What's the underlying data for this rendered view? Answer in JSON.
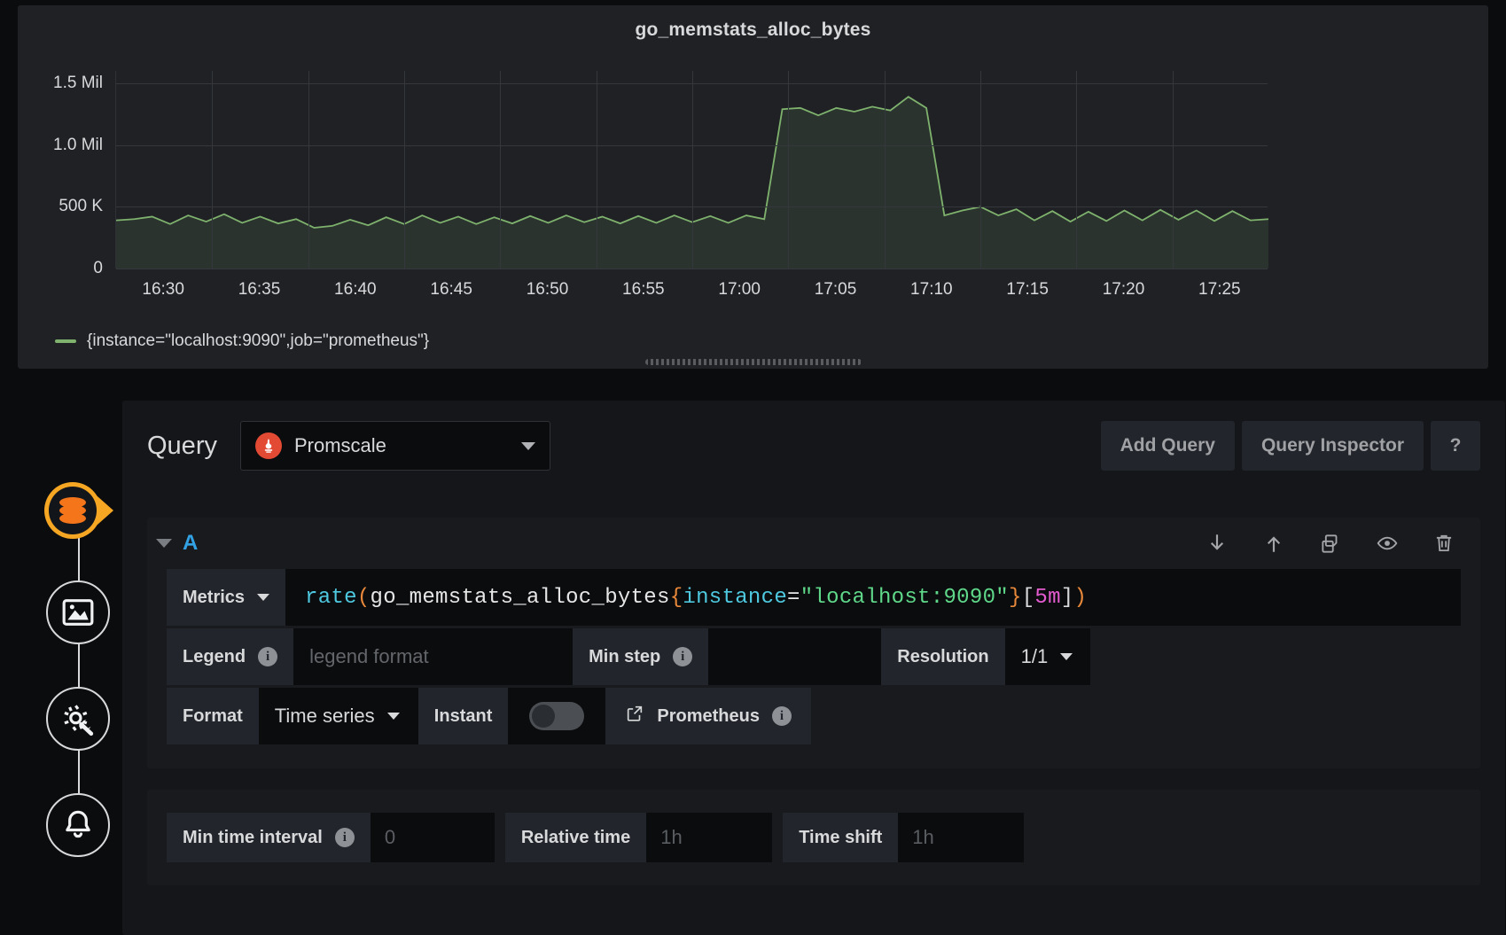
{
  "panel": {
    "title": "go_memstats_alloc_bytes",
    "legend_series": "{instance=\"localhost:9090\",job=\"prometheus\"}",
    "series_color": "#7eb26d"
  },
  "chart_data": {
    "type": "area",
    "title": "go_memstats_alloc_bytes",
    "xlabel": "",
    "ylabel": "",
    "grid": true,
    "legend_position": "bottom-left",
    "ytick_labels": [
      "1.5 Mil",
      "1.0 Mil",
      "500 K",
      "0"
    ],
    "ytick_values": [
      1500000,
      1000000,
      500000,
      0
    ],
    "ylim": [
      0,
      1600000
    ],
    "xtick_labels": [
      "16:30",
      "16:35",
      "16:40",
      "16:45",
      "16:50",
      "16:55",
      "17:00",
      "17:05",
      "17:10",
      "17:15",
      "17:20",
      "17:25"
    ],
    "series": [
      {
        "name": "{instance=\"localhost:9090\",job=\"prometheus\"}",
        "color": "#7eb26d",
        "x": [
          "16:28",
          "16:29",
          "16:30",
          "16:31",
          "16:32",
          "16:33",
          "16:34",
          "16:35",
          "16:36",
          "16:37",
          "16:38",
          "16:39",
          "16:40",
          "16:41",
          "16:42",
          "16:43",
          "16:44",
          "16:45",
          "16:46",
          "16:47",
          "16:48",
          "16:49",
          "16:50",
          "16:51",
          "16:52",
          "16:53",
          "16:54",
          "16:55",
          "16:56",
          "16:57",
          "16:58",
          "16:59",
          "17:00",
          "17:01",
          "17:02",
          "17:03",
          "17:04",
          "17:05",
          "17:06",
          "17:07",
          "17:08",
          "17:09",
          "17:10",
          "17:11",
          "17:12",
          "17:13",
          "17:14",
          "17:15",
          "17:16",
          "17:17",
          "17:18",
          "17:19",
          "17:20",
          "17:21",
          "17:22",
          "17:23",
          "17:24",
          "17:25",
          "17:26"
        ],
        "values": [
          390000,
          400000,
          420000,
          360000,
          430000,
          380000,
          440000,
          370000,
          420000,
          365000,
          400000,
          330000,
          345000,
          395000,
          350000,
          415000,
          360000,
          430000,
          370000,
          420000,
          360000,
          415000,
          365000,
          425000,
          370000,
          430000,
          375000,
          420000,
          365000,
          425000,
          370000,
          430000,
          375000,
          425000,
          370000,
          430000,
          400000,
          1290000,
          1300000,
          1240000,
          1300000,
          1270000,
          1310000,
          1280000,
          1390000,
          1300000,
          430000,
          470000,
          500000,
          430000,
          480000,
          390000,
          465000,
          380000,
          460000,
          385000,
          470000,
          390000,
          475000,
          395000,
          470000,
          385000,
          465000,
          390000,
          400000
        ]
      }
    ]
  },
  "query": {
    "section_label": "Query",
    "datasource_name": "Promscale",
    "datasource_icon": "prometheus-flame-icon",
    "add_query_label": "Add Query",
    "query_inspector_label": "Query Inspector",
    "help_label": "?",
    "ref_id": "A",
    "row_icons": [
      {
        "name": "move-query-down-icon",
        "glyph": "arrow-down"
      },
      {
        "name": "move-query-up-icon",
        "glyph": "arrow-up"
      },
      {
        "name": "duplicate-query-icon",
        "glyph": "copy"
      },
      {
        "name": "toggle-query-visibility-icon",
        "glyph": "eye"
      },
      {
        "name": "remove-query-icon",
        "glyph": "trash"
      }
    ],
    "metrics_label": "Metrics",
    "expression": "rate(go_memstats_alloc_bytes{instance=\"localhost:9090\"}[5m])",
    "expression_tokens": [
      {
        "text": "rate",
        "type": "function"
      },
      {
        "text": "(",
        "type": "paren"
      },
      {
        "text": "go_memstats_alloc_bytes",
        "type": "metric"
      },
      {
        "text": "{",
        "type": "brace"
      },
      {
        "text": "instance",
        "type": "label"
      },
      {
        "text": "=",
        "type": "operator"
      },
      {
        "text": "\"localhost:9090\"",
        "type": "string"
      },
      {
        "text": "}",
        "type": "brace"
      },
      {
        "text": "[",
        "type": "bracket"
      },
      {
        "text": "5m",
        "type": "duration"
      },
      {
        "text": "]",
        "type": "bracket"
      },
      {
        "text": ")",
        "type": "paren"
      }
    ],
    "legend_label": "Legend",
    "legend_value": "",
    "legend_placeholder": "legend format",
    "min_step_label": "Min step",
    "min_step_value": "",
    "min_step_placeholder": "",
    "resolution_label": "Resolution",
    "resolution_value": "1/1",
    "format_label": "Format",
    "format_value": "Time series",
    "instant_label": "Instant",
    "instant_enabled": false,
    "prometheus_link_label": "Prometheus"
  },
  "options": {
    "min_time_interval_label": "Min time interval",
    "min_time_interval_value": "",
    "min_time_interval_placeholder": "0",
    "relative_time_label": "Relative time",
    "relative_time_value": "",
    "relative_time_placeholder": "1h",
    "time_shift_label": "Time shift",
    "time_shift_value": "",
    "time_shift_placeholder": "1h"
  },
  "sidebar": {
    "items": [
      {
        "name": "promscale-logo-icon",
        "label": "Promscale"
      },
      {
        "name": "dashboard-icon",
        "label": "Dashboards"
      },
      {
        "name": "configuration-icon",
        "label": "Configuration"
      },
      {
        "name": "alerting-bell-icon",
        "label": "Alerting"
      }
    ]
  }
}
